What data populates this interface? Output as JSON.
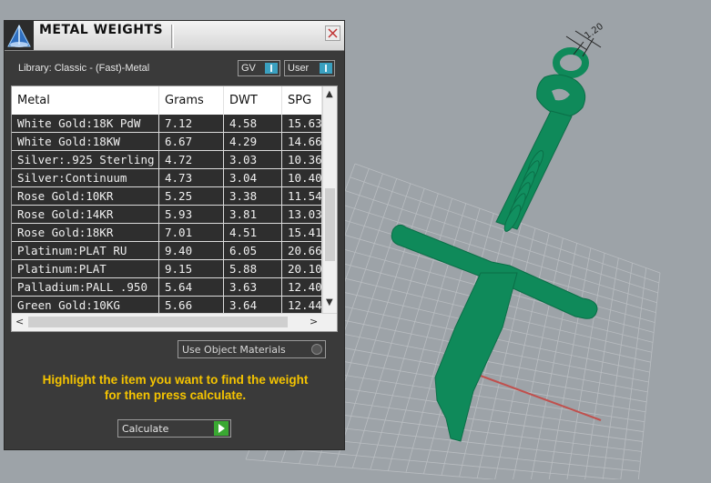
{
  "panel": {
    "title": "METAL WEIGHTS",
    "library_label": "Library: Classic - (Fast)-Metal",
    "gv_toggle": "GV",
    "user_toggle": "User"
  },
  "table": {
    "headers": [
      "Metal",
      "Grams",
      "DWT",
      "SPG"
    ],
    "rows": [
      [
        "White Gold:18K PdW",
        "7.12",
        "4.58",
        "15.63"
      ],
      [
        "White Gold:18KW",
        "6.67",
        "4.29",
        "14.66"
      ],
      [
        "Silver:.925 Sterling",
        "4.72",
        "3.03",
        "10.36"
      ],
      [
        "Silver:Continuum",
        "4.73",
        "3.04",
        "10.40"
      ],
      [
        "Rose Gold:10KR",
        "5.25",
        "3.38",
        "11.54"
      ],
      [
        "Rose Gold:14KR",
        "5.93",
        "3.81",
        "13.03"
      ],
      [
        "Rose Gold:18KR",
        "7.01",
        "4.51",
        "15.41"
      ],
      [
        "Platinum:PLAT RU",
        "9.40",
        "6.05",
        "20.66"
      ],
      [
        "Platinum:PLAT",
        "9.15",
        "5.88",
        "20.10"
      ],
      [
        "Palladium:PALL .950",
        "5.64",
        "3.63",
        "12.40"
      ],
      [
        "Green Gold:10KG",
        "5.66",
        "3.64",
        "12.44"
      ]
    ]
  },
  "use_object_materials": "Use Object Materials",
  "hint": {
    "line1": "Highlight the item you want to find the weight",
    "line2": "for then press calculate."
  },
  "calculate_button": "Calculate",
  "viewport": {
    "dimension_label": "1.20",
    "model_color": "#0f8a5a",
    "grid_color": "#b9bdc1"
  },
  "colors": {
    "accent_blue": "#3aa0c0",
    "accent_green": "#3aa832",
    "hint_yellow": "#f5c400"
  }
}
